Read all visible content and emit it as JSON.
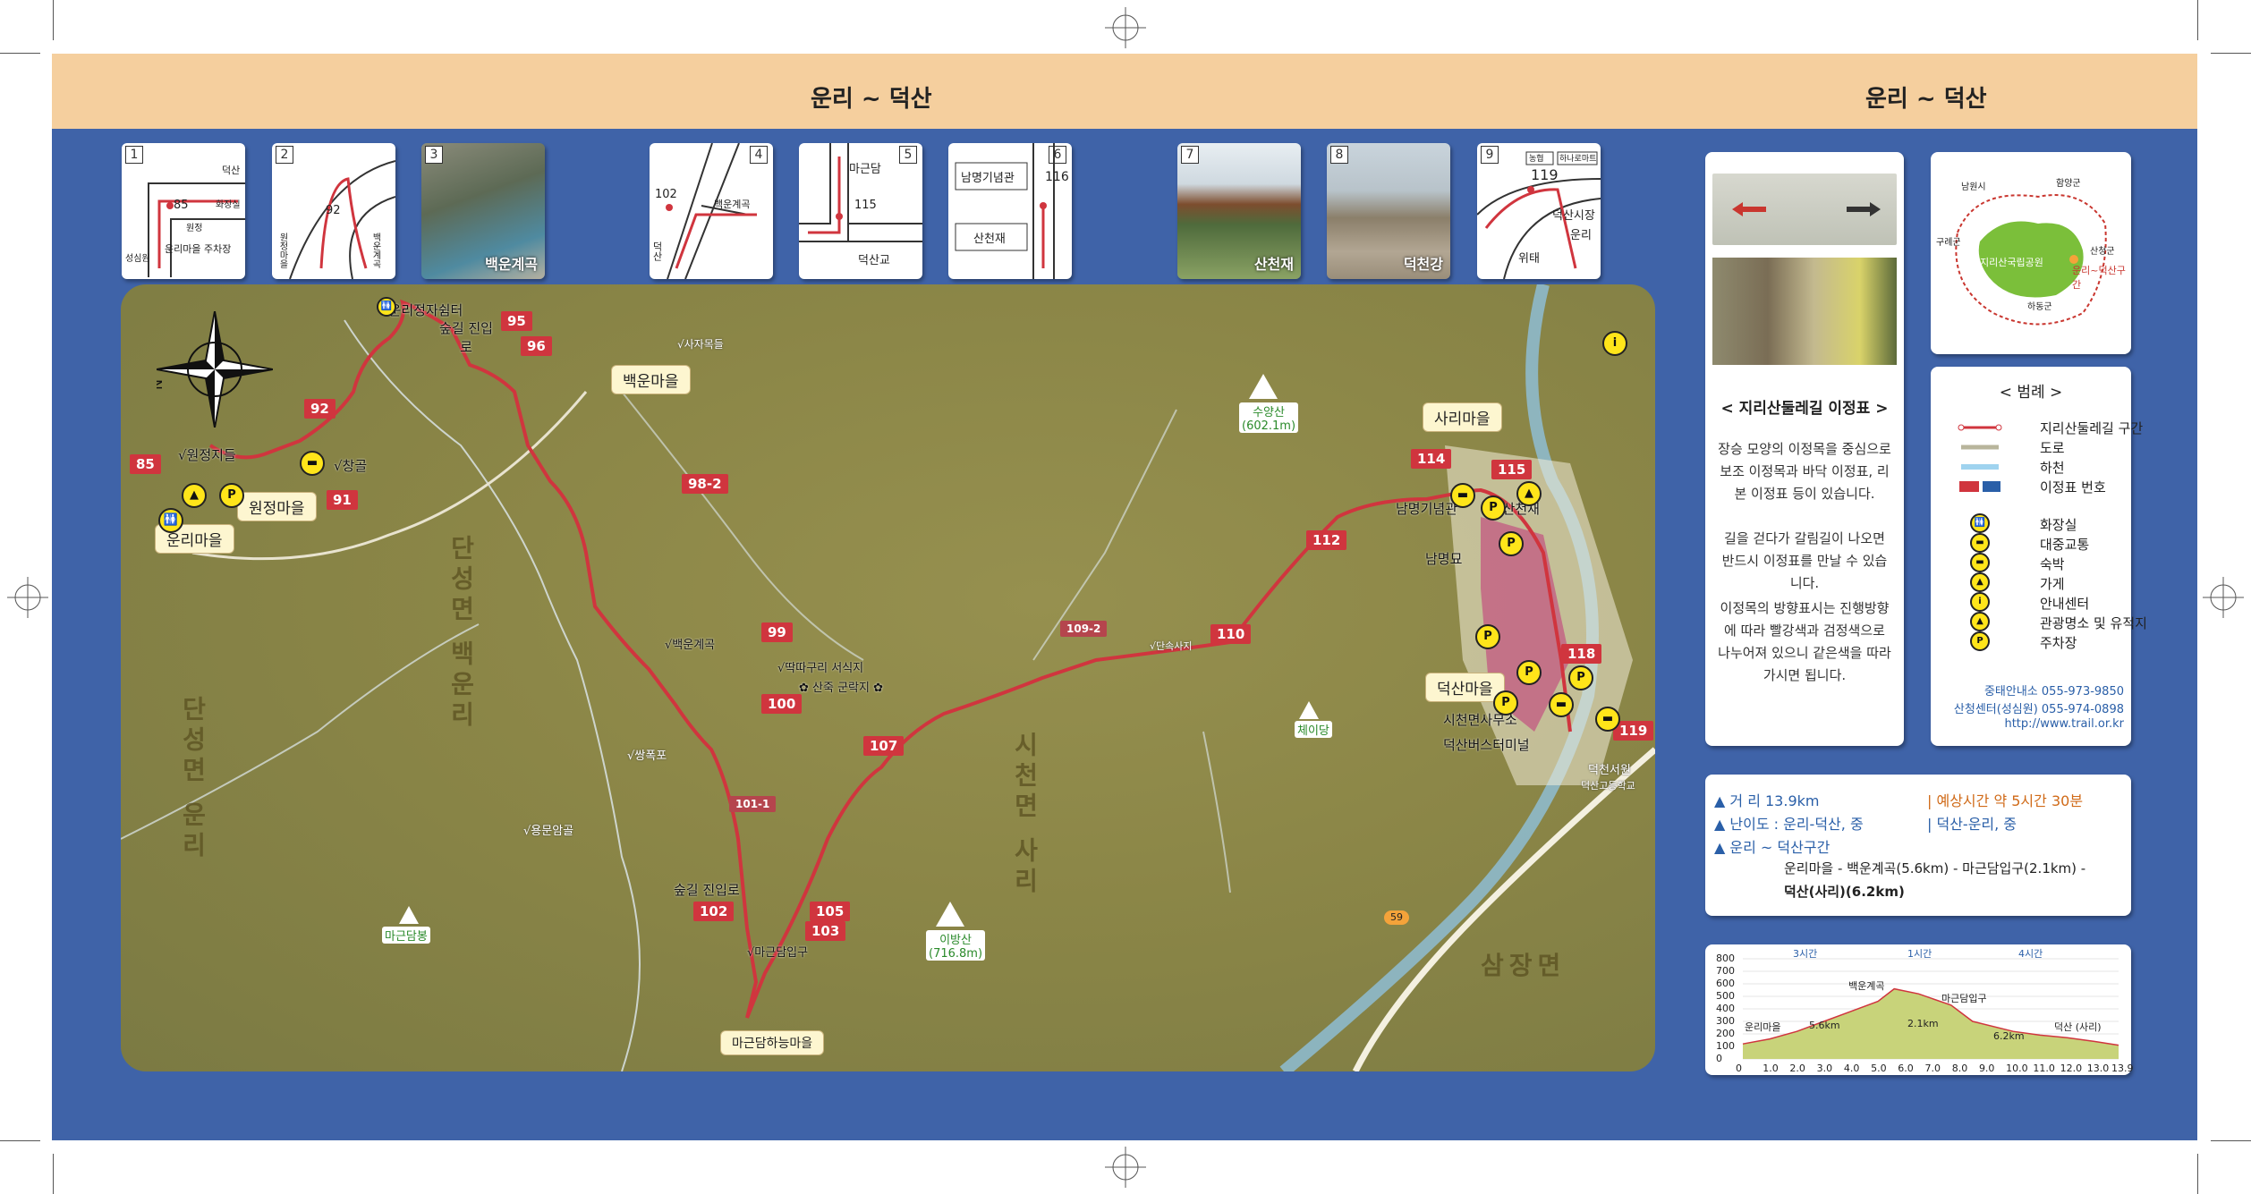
{
  "header": {
    "title_left": "운리 ~ 덕산",
    "title_right": "운리 ~ 덕산"
  },
  "thumbs": [
    {
      "num": "1",
      "type": "diagram",
      "labels": [
        "덕산",
        "85",
        "원정",
        "화장실",
        "성심원",
        "운리마을 주차장"
      ]
    },
    {
      "num": "2",
      "type": "diagram",
      "labels": [
        "92",
        "원정마을",
        "백운계곡"
      ]
    },
    {
      "num": "3",
      "type": "photo",
      "caption": "백운계곡"
    },
    {
      "num": "4",
      "type": "diagram",
      "labels": [
        "102",
        "백운계곡",
        "덕산"
      ]
    },
    {
      "num": "5",
      "type": "diagram",
      "labels": [
        "마근담",
        "115",
        "덕산교"
      ]
    },
    {
      "num": "6",
      "type": "diagram",
      "labels": [
        "남명기념관",
        "116",
        "산천재"
      ]
    },
    {
      "num": "7",
      "type": "photo",
      "caption": "산천재"
    },
    {
      "num": "8",
      "type": "photo",
      "caption": "덕천강"
    },
    {
      "num": "9",
      "type": "diagram",
      "labels": [
        "농협",
        "하나로마트",
        "119",
        "덕산시장",
        "운리",
        "위태"
      ]
    }
  ],
  "map": {
    "waypoints": [
      "85",
      "92",
      "91",
      "95",
      "96",
      "98-2",
      "99",
      "100",
      "101-1",
      "102",
      "103",
      "105",
      "107",
      "109-2",
      "110",
      "112",
      "114",
      "115",
      "118",
      "119"
    ],
    "towns": [
      "백운마을",
      "원정마을",
      "운리마을",
      "사리마을",
      "덕산마을",
      "마근담하능마을"
    ],
    "labels": [
      "√운리정자쉼터",
      "숲길 진입로",
      "√원정지들",
      "√창골",
      "√사자목들",
      "√백운계곡",
      "√딱따구리 서식지",
      "✿ 산죽 군락지 ✿",
      "√쌍폭포",
      "√용문암골",
      "숲길 진입로",
      "√마근담입구",
      "남명기념관",
      "√산천재",
      "남명묘",
      "시천면사무소",
      "덕산버스터미널",
      "덕천서원",
      "덕산고등학교",
      "√단속사지"
    ],
    "areas": [
      "단성면 백운리",
      "단성면 운리",
      "시천면 사리",
      "삼장면"
    ],
    "peaks": [
      {
        "name": "수양산",
        "height": "(602.1m)"
      },
      {
        "name": "이방산",
        "height": "(716.8m)"
      },
      {
        "name": "마근담봉",
        "height": ""
      },
      {
        "name": "체이당",
        "height": ""
      }
    ],
    "road": "59",
    "stream": "덕천강"
  },
  "sign_panel": {
    "title": "< 지리산둘레길 이정표 >",
    "para1": "장승 모양의 이정목을 중심으로 보조 이정목과 바닥 이정표, 리본 이정표 등이 있습니다.",
    "para2": "길을 걷다가 갈림길이 나오면 반드시 이정표를 만날 수 있습니다.",
    "para3": "이정목의 방향표시는 진행방향에 따라 빨강색과 검정색으로 나누어져 있으니 같은색을 따라 가시면 됩니다."
  },
  "locator": {
    "title": "지리산국립공원",
    "labels": [
      "남원시",
      "함양군",
      "구례군",
      "산청군",
      "하동군",
      "운리~덕산구간"
    ]
  },
  "legend": {
    "title": "< 범례 >",
    "items": [
      "지리산둘레길 구간",
      "도로",
      "하천",
      "이정표 번호",
      "화장실",
      "대중교통",
      "숙박",
      "가게",
      "안내센터",
      "관광명소 및 유적지",
      "주차장"
    ],
    "contact1": "중태안내소 055-973-9850",
    "contact2": "산청센터(성심원) 055-974-0898",
    "url": "http://www.trail.or.kr"
  },
  "info": {
    "distance": "▲ 거 리 13.9km",
    "time": "| 예상시간 약 5시간 30분",
    "difficulty": "▲ 난이도 : 운리-덕산, 중",
    "difficulty2": "| 덕산-운리, 중",
    "section": "▲ 운리 ~ 덕산구간",
    "route1": "운리마을 - 백운계곡(5.6km) - 마근담입구(2.1km) -",
    "route2": "덕산(사리)(6.2km)"
  },
  "elevation": {
    "yticks": [
      "800",
      "700",
      "600",
      "500",
      "400",
      "300",
      "200",
      "100",
      "0"
    ],
    "xticks": [
      "0",
      "1.0",
      "2.0",
      "3.0",
      "4.0",
      "5.0",
      "6.0",
      "7.0",
      "8.0",
      "9.0",
      "10.0",
      "11.0",
      "12.0",
      "13.0",
      "13.9"
    ],
    "times": [
      "3시간",
      "1시간",
      "4시간"
    ],
    "points": [
      "운리마을",
      "백운계곡",
      "마근담입구",
      "덕산 (사리)"
    ],
    "segments": [
      "5.6km",
      "2.1km",
      "6.2km"
    ]
  },
  "colors": {
    "trail": "#d0353e",
    "header": "#f5cf9e",
    "background": "#3f63a8"
  }
}
